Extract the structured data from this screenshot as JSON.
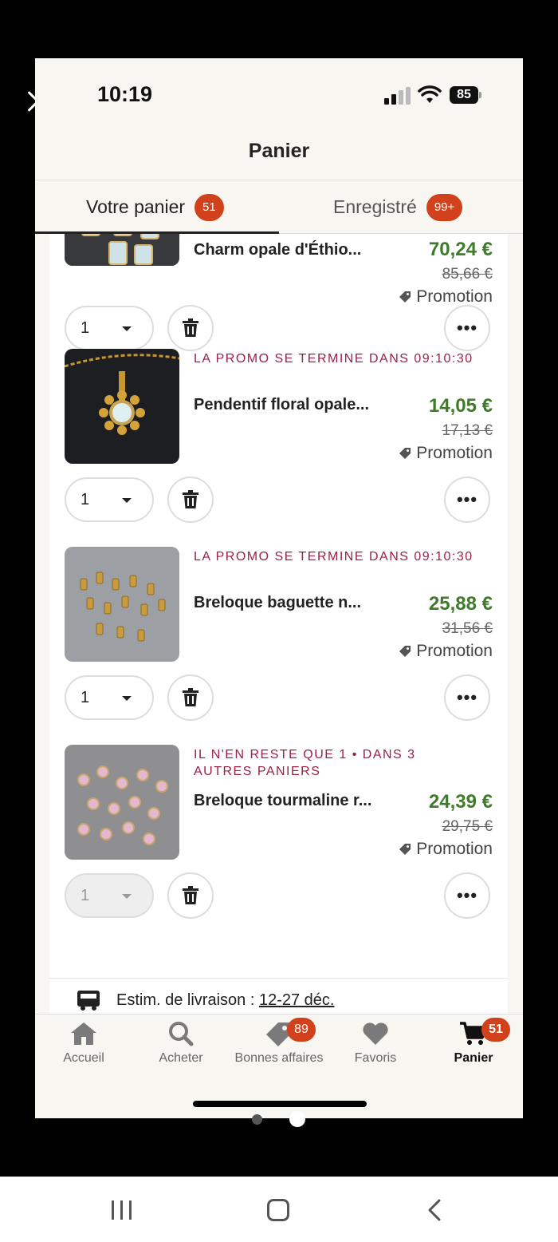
{
  "status_bar": {
    "time": "10:19",
    "battery": "85"
  },
  "header": {
    "title": "Panier"
  },
  "tabs": [
    {
      "label": "Votre panier",
      "badge": "51"
    },
    {
      "label": "Enregistré",
      "badge": "99+"
    }
  ],
  "items": [
    {
      "promo": "",
      "name": "Charm opale d'Éthio...",
      "price": "70,24 €",
      "old_price": "85,66 €",
      "tag": "Promotion",
      "qty": "1",
      "image": "opal-rectangular-charms"
    },
    {
      "promo": "LA PROMO SE TERMINE DANS 09:10:30",
      "name": "Pendentif floral opale...",
      "price": "14,05 €",
      "old_price": "17,13 €",
      "tag": "Promotion",
      "qty": "1",
      "image": "floral-opal-pendant"
    },
    {
      "promo": "LA PROMO SE TERMINE DANS 09:10:30",
      "name": "Breloque baguette n...",
      "price": "25,88 €",
      "old_price": "31,56 €",
      "tag": "Promotion",
      "qty": "1",
      "image": "baguette-charms"
    },
    {
      "promo": "IL N'EN RESTE QUE 1 • DANS 3 AUTRES PANIERS",
      "name": "Breloque tourmaline r...",
      "price": "24,39 €",
      "old_price": "29,75 €",
      "tag": "Promotion",
      "qty": "1",
      "image": "pink-tourmaline-charms"
    }
  ],
  "delivery": {
    "label": "Estim. de livraison : ",
    "dates": "12-27 déc."
  },
  "tabbar": [
    {
      "label": "Accueil",
      "icon": "home-icon"
    },
    {
      "label": "Acheter",
      "icon": "search-icon"
    },
    {
      "label": "Bonnes affaires",
      "icon": "tag-icon",
      "badge": "89"
    },
    {
      "label": "Favoris",
      "icon": "heart-icon"
    },
    {
      "label": "Panier",
      "icon": "cart-icon",
      "badge": "51"
    }
  ],
  "colors": {
    "accent": "#d1411b",
    "price_green": "#3f7b2b",
    "promo_red": "#9c2043",
    "background": "#f7f6f1"
  }
}
